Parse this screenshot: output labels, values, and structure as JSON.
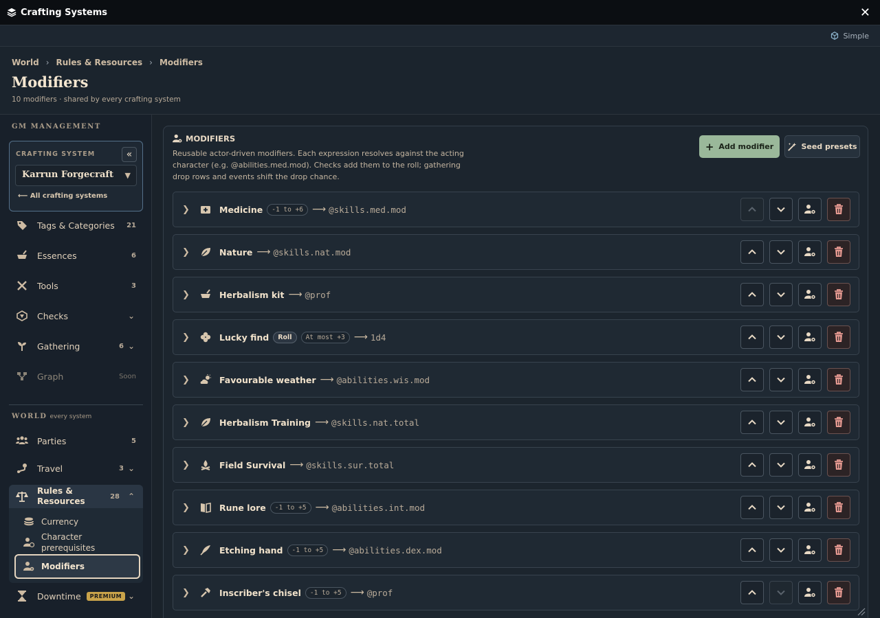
{
  "window": {
    "title": "Crafting Systems",
    "close_label": "✕"
  },
  "modebar": {
    "mode_label": "Simple"
  },
  "header": {
    "breadcrumb": [
      "World",
      "Rules & Resources",
      "Modifiers"
    ],
    "title": "Modifiers",
    "subtitle": "10 modifiers · shared by every crafting system"
  },
  "sidebar": {
    "gm_label": "GM MANAGEMENT",
    "crafting_system": {
      "label": "CRAFTING SYSTEM",
      "selected": "Karrun Forgecraft",
      "back_label": "All crafting systems"
    },
    "gm_items": [
      {
        "label": "Tags & Categories",
        "count": "21",
        "icon": "tag-icon"
      },
      {
        "label": "Essences",
        "count": "6",
        "icon": "mortar-icon"
      },
      {
        "label": "Tools",
        "count": "3",
        "icon": "tools-icon"
      },
      {
        "label": "Checks",
        "count": "",
        "icon": "d20-icon"
      },
      {
        "label": "Gathering",
        "count": "6",
        "icon": "sprout-icon"
      },
      {
        "label": "Graph",
        "count": "Soon",
        "icon": "graph-icon"
      }
    ],
    "world_label": "WORLD",
    "world_sub": "every system",
    "world_items": [
      {
        "label": "Parties",
        "count": "5",
        "icon": "users-icon"
      },
      {
        "label": "Travel",
        "count": "3",
        "icon": "route-icon"
      }
    ],
    "rules": {
      "label": "Rules & Resources",
      "count": "28",
      "subitems": [
        "Currency",
        "Character prerequisites",
        "Modifiers"
      ]
    },
    "downtime": {
      "label": "Downtime",
      "badge": "PREMIUM"
    }
  },
  "panel": {
    "title": "MODIFIERS",
    "description": "Reusable actor-driven modifiers. Each expression resolves against the acting character (e.g. @abilities.med.mod). Checks add them to the roll; gathering drop rows and events shift the drop chance.",
    "add_label": "Add modifier",
    "seed_label": "Seed presets"
  },
  "modifiers": [
    {
      "name": "Medicine",
      "icon": "medkit-icon",
      "roll": "",
      "range": "-1 to +6",
      "expr": "@skills.med.mod"
    },
    {
      "name": "Nature",
      "icon": "leaf-icon",
      "roll": "",
      "range": "",
      "expr": "@skills.nat.mod"
    },
    {
      "name": "Herbalism kit",
      "icon": "mortar-icon",
      "roll": "",
      "range": "",
      "expr": "@prof"
    },
    {
      "name": "Lucky find",
      "icon": "clover-icon",
      "roll": "Roll",
      "range": "At most +3",
      "expr": "1d4"
    },
    {
      "name": "Favourable weather",
      "icon": "weather-icon",
      "roll": "",
      "range": "",
      "expr": "@abilities.wis.mod"
    },
    {
      "name": "Herbalism Training",
      "icon": "leaf-icon",
      "roll": "",
      "range": "",
      "expr": "@skills.nat.total"
    },
    {
      "name": "Field Survival",
      "icon": "campfire-icon",
      "roll": "",
      "range": "",
      "expr": "@skills.sur.total"
    },
    {
      "name": "Rune lore",
      "icon": "book-icon",
      "roll": "",
      "range": "-1 to +5",
      "expr": "@abilities.int.mod"
    },
    {
      "name": "Etching hand",
      "icon": "quill-icon",
      "roll": "",
      "range": "-1 to +5",
      "expr": "@abilities.dex.mod"
    },
    {
      "name": "Inscriber's chisel",
      "icon": "hammer-icon",
      "roll": "",
      "range": "-1 to +5",
      "expr": "@prof"
    }
  ]
}
